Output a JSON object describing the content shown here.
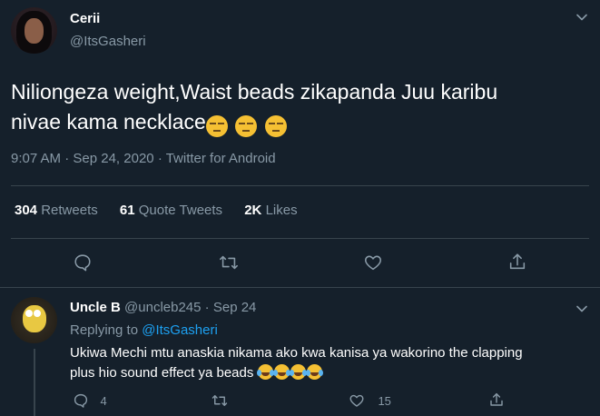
{
  "tweet": {
    "display_name": "Cerii",
    "handle": "@ItsGasheri",
    "text_line1": "Niliongeza weight,Waist beads zikapanda Juu karibu",
    "text_line2": "nivae kama necklace",
    "emoji_name": "unamused-face",
    "emoji_count": 3,
    "time": "9:07 AM",
    "date": "Sep 24, 2020",
    "source": "Twitter for Android",
    "separator": "·",
    "stats": {
      "retweets_count": "304",
      "retweets_label": "Retweets",
      "quotes_count": "61",
      "quotes_label": "Quote Tweets",
      "likes_count": "2K",
      "likes_label": "Likes"
    },
    "actions": [
      "reply-icon",
      "retweet-icon",
      "like-icon",
      "share-icon"
    ]
  },
  "reply": {
    "display_name": "Uncle B",
    "handle": "@uncleb245",
    "separator": "·",
    "date": "Sep 24",
    "replying_prefix": "Replying to",
    "replying_handle": "@ItsGasheri",
    "text_line1": "Ukiwa Mechi mtu anaskia nikama ako kwa kanisa ya wakorino the clapping",
    "text_line2": "plus hio sound effect ya beads",
    "emoji_name": "face-with-tears-of-joy",
    "emoji_count": 4,
    "reply_count": "4",
    "like_count": "15"
  },
  "colors": {
    "background": "#15202b",
    "text": "#ffffff",
    "secondary": "#8899a6",
    "link": "#1da1f2",
    "divider": "#38444d"
  }
}
